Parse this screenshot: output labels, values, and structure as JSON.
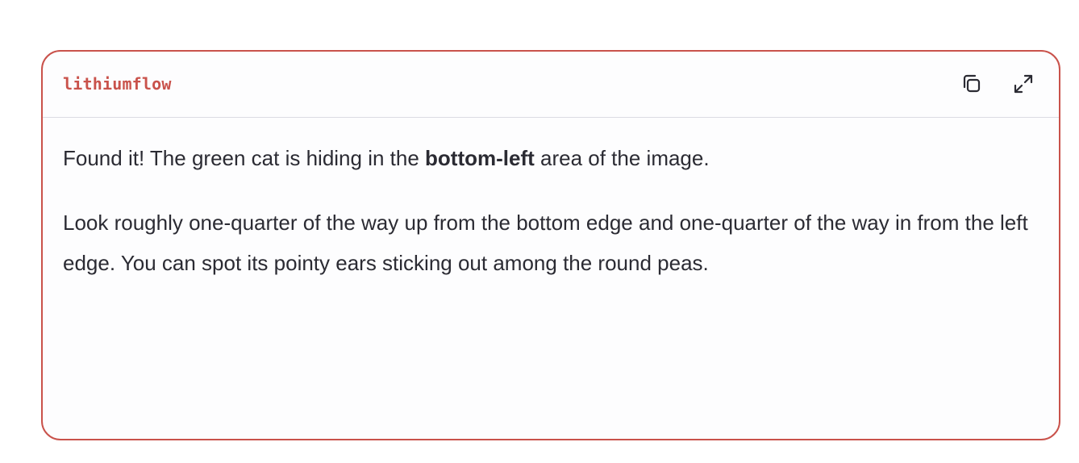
{
  "card": {
    "model_name": "lithiumflow",
    "accent_color": "#c9524b",
    "actions": {
      "copy_icon": "copy-icon",
      "expand_icon": "expand-icon"
    },
    "response": {
      "p1_before": "Found it! The green cat is hiding in the ",
      "p1_bold": "bottom-left",
      "p1_after": " area of the image.",
      "p2": "Look roughly one-quarter of the way up from the bottom edge and one-quarter of the way in from the left edge. You can spot its pointy ears sticking out among the round peas."
    }
  }
}
